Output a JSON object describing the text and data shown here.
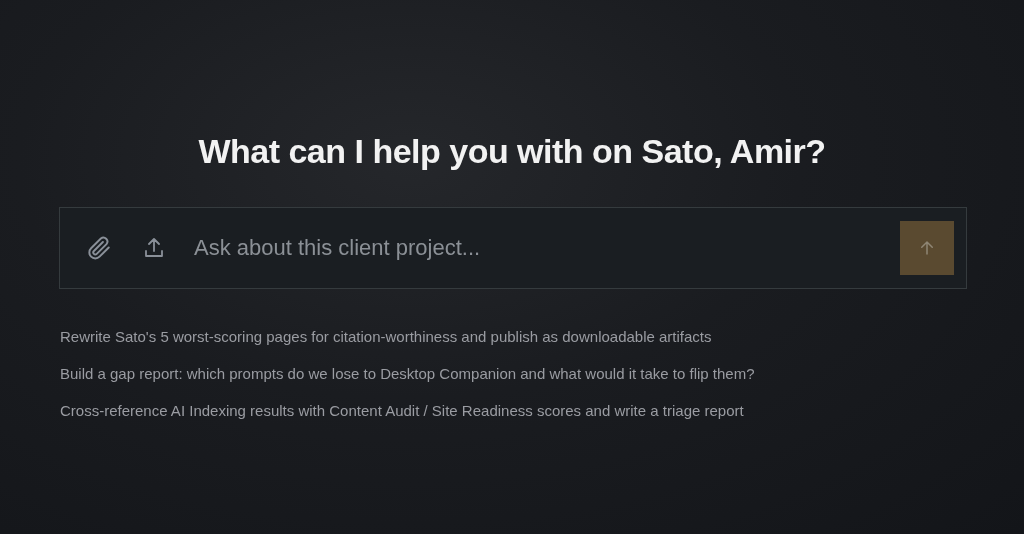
{
  "heading": "What can I help you with on Sato, Amir?",
  "composer": {
    "placeholder": "Ask about this client project...",
    "send_disabled": true
  },
  "suggestions": [
    "Rewrite Sato's 5 worst-scoring pages for citation-worthiness and publish as downloadable artifacts",
    "Build a gap report: which prompts do we lose to Desktop Companion and what would it take to flip them?",
    "Cross-reference AI Indexing results with Content Audit / Site Readiness scores and write a triage report"
  ]
}
